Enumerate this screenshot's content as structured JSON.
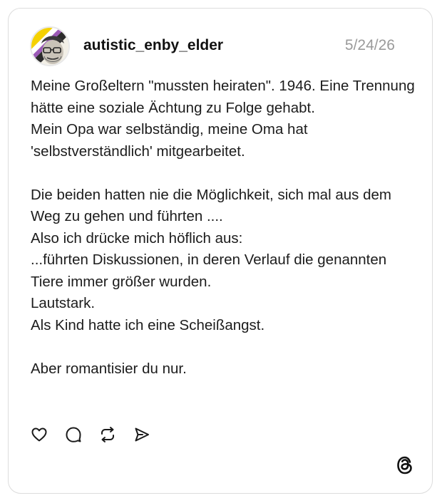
{
  "post": {
    "username": "autistic_enby_elder",
    "date": "5/24/26",
    "lines": [
      "Meine Großeltern \"mussten heiraten\". 1946. Eine Trennung hätte eine soziale Ächtung zu Folge gehabt.",
      "Mein Opa war selbständig, meine Oma hat 'selbstverständlich' mitgearbeitet.",
      "",
      "Die beiden hatten nie die Möglichkeit, sich mal aus dem Weg zu gehen und führten ....",
      "Also ich drücke mich höflich aus:",
      "...führten Diskussionen, in deren Verlauf die genannten Tiere immer größer wurden.",
      "Lautstark.",
      "Als Kind hatte ich eine Scheißangst.",
      "",
      "Aber romantisier du nur."
    ]
  },
  "actions": [
    {
      "icon": "heart-icon"
    },
    {
      "icon": "comment-icon"
    },
    {
      "icon": "repost-icon"
    },
    {
      "icon": "share-icon"
    }
  ],
  "brand": {
    "icon": "threads-logo-icon"
  }
}
